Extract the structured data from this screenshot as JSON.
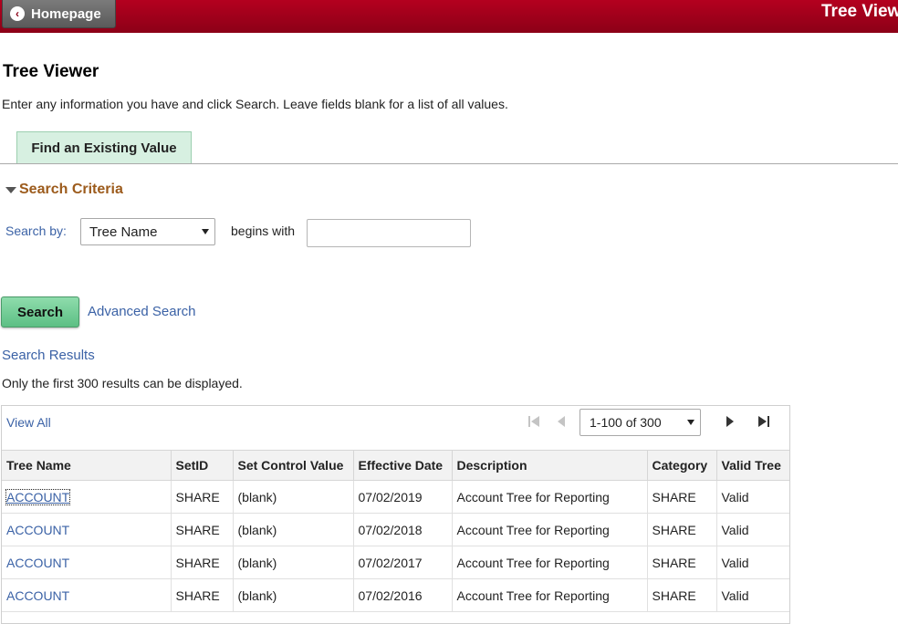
{
  "header": {
    "home_label": "Homepage",
    "banner_title": "Tree Viewer",
    "brand_color": "#a3001c"
  },
  "page": {
    "title": "Tree Viewer",
    "instructions": "Enter any information you have and click Search. Leave fields blank for a list of all values."
  },
  "tabs": [
    {
      "label": "Find an Existing Value",
      "active": true
    }
  ],
  "criteria": {
    "header": "Search Criteria",
    "search_by_label": "Search by:",
    "search_by_value": "Tree Name",
    "operator_label": "begins with",
    "input_value": ""
  },
  "actions": {
    "search_label": "Search",
    "advanced_label": "Advanced Search"
  },
  "results": {
    "header": "Search Results",
    "note": "Only the first 300 results can be displayed.",
    "view_all": "View All",
    "pager_value": "1-100 of 300",
    "columns": [
      "Tree Name",
      "SetID",
      "Set Control Value",
      "Effective Date",
      "Description",
      "Category",
      "Valid Tree"
    ],
    "rows": [
      [
        "ACCOUNT",
        "SHARE",
        "(blank)",
        "07/02/2019",
        "Account Tree for Reporting",
        "SHARE",
        "Valid"
      ],
      [
        "ACCOUNT",
        "SHARE",
        "(blank)",
        "07/02/2018",
        "Account Tree for Reporting",
        "SHARE",
        "Valid"
      ],
      [
        "ACCOUNT",
        "SHARE",
        "(blank)",
        "07/02/2017",
        "Account Tree for Reporting",
        "SHARE",
        "Valid"
      ],
      [
        "ACCOUNT",
        "SHARE",
        "(blank)",
        "07/02/2016",
        "Account Tree for Reporting",
        "SHARE",
        "Valid"
      ]
    ]
  },
  "icons": {
    "back": "chevron-left-icon",
    "collapse": "triangle-down-icon",
    "first": "first-page-icon",
    "prev": "previous-page-icon",
    "next": "next-page-icon",
    "last": "last-page-icon"
  }
}
